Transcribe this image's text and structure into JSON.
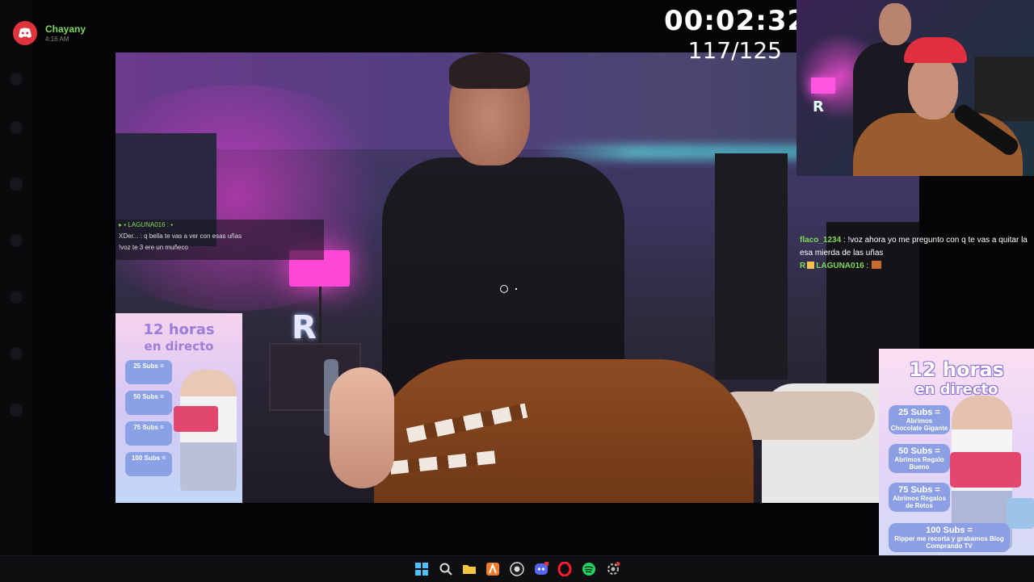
{
  "notification": {
    "app_icon": "discord-icon",
    "name": "Chayany",
    "time": "4:16 AM"
  },
  "stream_overlay": {
    "timer": "00:02:32",
    "counter": "117/125"
  },
  "chat": {
    "messages": [
      {
        "user": "flaco_1234",
        "text": ": !voz ahora yo me pregunto con q te vas a quitar la esa mierda de las uñas"
      },
      {
        "user": "LAGUNA016",
        "text": ":",
        "badges": [
          "R",
          "crown"
        ],
        "emote": "emote"
      }
    ]
  },
  "poster": {
    "title": "12 horas",
    "subtitle": "en directo",
    "goals": [
      {
        "subs": "25 Subs =",
        "desc": "Abrimos Chocolate Gigante"
      },
      {
        "subs": "50 Subs =",
        "desc": "Abrimos Regalo Bueno"
      },
      {
        "subs": "75 Subs =",
        "desc": "Abrimos Regalos de Retos"
      },
      {
        "subs": "100 Subs =",
        "desc": "Ripper me recorta y grabamos Blog Comprando TV"
      }
    ]
  },
  "taskbar": {
    "icons": [
      "windows-start-icon",
      "search-icon",
      "file-explorer-icon",
      "app-icon",
      "obs-icon",
      "discord-icon",
      "opera-icon",
      "spotify-icon",
      "settings-icon"
    ]
  },
  "colors": {
    "username_green": "#7ed957",
    "discord_red": "#e0343c",
    "poster_purple": "#8d6fd6"
  }
}
